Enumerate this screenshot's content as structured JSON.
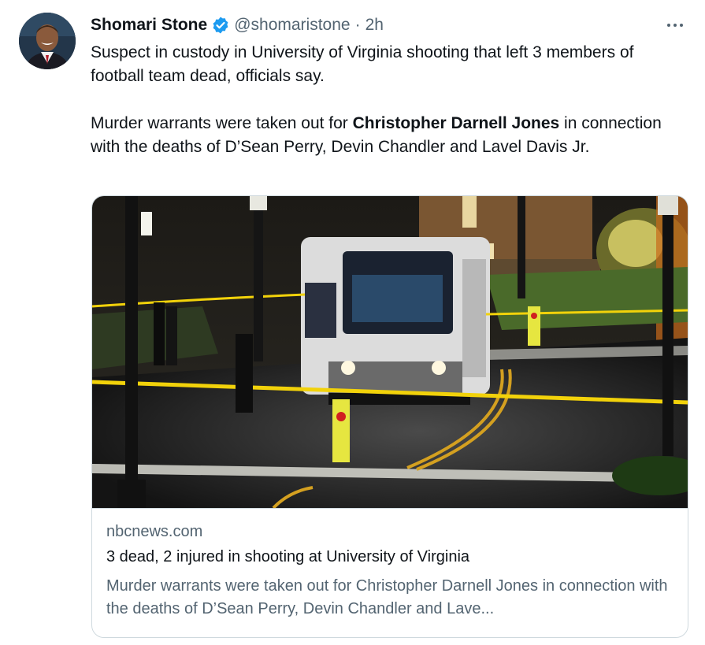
{
  "tweet": {
    "author_name": "Shomari Stone",
    "handle": "@shomaristone",
    "separator": "·",
    "time": "2h",
    "verified": true,
    "more_icon": "more-horizontal-icon",
    "paragraph1": "Suspect in custody in University of Virginia shooting that left 3 members of football team dead, officials say.",
    "paragraph2_pre": "Murder warrants were taken out for ",
    "paragraph2_bold": "Christopher Darnell Jones",
    "paragraph2_post": " in connection with the deaths of D’Sean Perry, Devin Chandler and Lavel Davis Jr."
  },
  "card": {
    "domain": "nbcnews.com",
    "title": "3 dead, 2 injured in shooting at University of Virginia",
    "description": "Murder warrants were taken out for Christopher Darnell Jones in connection with the deaths of D’Sean Perry, Devin Chandler and Lave..."
  },
  "colors": {
    "accent": "#1d9bf0",
    "text": "#0f1419",
    "secondary": "#536471",
    "border": "#cfd9de",
    "police_tape": "#f2d20a"
  }
}
